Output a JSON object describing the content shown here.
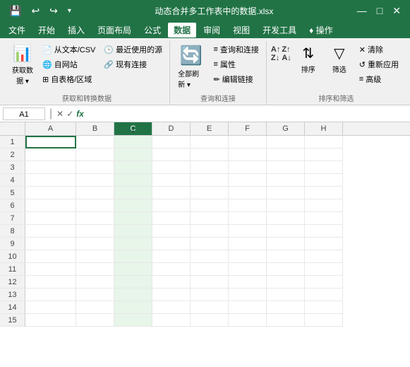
{
  "titlebar": {
    "filename": "动态合并多工作表中的数据.xlsx",
    "save_icon": "💾",
    "undo_icon": "↩",
    "redo_icon": "↪",
    "customize_icon": "⬇"
  },
  "menubar": {
    "items": [
      {
        "label": "文件",
        "active": false
      },
      {
        "label": "开始",
        "active": false
      },
      {
        "label": "插入",
        "active": false
      },
      {
        "label": "页面布局",
        "active": false
      },
      {
        "label": "公式",
        "active": false
      },
      {
        "label": "数据",
        "active": true
      },
      {
        "label": "审阅",
        "active": false
      },
      {
        "label": "视图",
        "active": false
      },
      {
        "label": "开发工具",
        "active": false
      },
      {
        "label": "♦ 操作",
        "active": false
      }
    ]
  },
  "ribbon": {
    "groups": [
      {
        "label": "获取和转换数据",
        "buttons_large": [
          {
            "id": "get-data",
            "icon": "📊",
            "label": "获取数\n据 ▾"
          }
        ],
        "buttons_small": [
          {
            "id": "from-text-csv",
            "icon": "📄",
            "label": "从文本/CSV"
          },
          {
            "id": "from-web",
            "icon": "🌐",
            "label": "自网站"
          },
          {
            "id": "from-table",
            "icon": "⊞",
            "label": "自表格/区域"
          },
          {
            "id": "recent-sources",
            "icon": "🕒",
            "label": "最近使用的源"
          },
          {
            "id": "existing-connections",
            "icon": "🔗",
            "label": "现有连接"
          }
        ]
      },
      {
        "label": "查询和连接",
        "buttons_large": [
          {
            "id": "refresh-all",
            "icon": "🔄",
            "label": "全部刷新 ▾"
          }
        ],
        "buttons_small": [
          {
            "id": "queries-connections",
            "icon": "≡",
            "label": "查询和连接"
          },
          {
            "id": "properties",
            "icon": "≡",
            "label": "属性"
          },
          {
            "id": "edit-links",
            "icon": "✏",
            "label": "编辑链接"
          }
        ]
      },
      {
        "label": "排序和筛选",
        "buttons_large": [
          {
            "id": "sort-az",
            "icon": "AZ↓",
            "label": ""
          },
          {
            "id": "sort-za",
            "icon": "ZA↑",
            "label": ""
          },
          {
            "id": "sort",
            "icon": "⇅",
            "label": "排序"
          },
          {
            "id": "filter",
            "icon": "▼",
            "label": "筛选"
          },
          {
            "id": "clear",
            "icon": "✕",
            "label": "清除"
          },
          {
            "id": "reapply",
            "icon": "↺",
            "label": "重新"
          },
          {
            "id": "advanced",
            "icon": "≡",
            "label": "高级"
          }
        ]
      }
    ]
  },
  "formulabar": {
    "cell_ref": "A1",
    "cancel_icon": "✕",
    "confirm_icon": "✓",
    "function_icon": "fx",
    "formula_value": ""
  },
  "spreadsheet": {
    "columns": [
      "A",
      "B",
      "C",
      "D",
      "E",
      "F",
      "G",
      "H"
    ],
    "active_cell": "A1",
    "active_col": "C",
    "rows": 15
  }
}
